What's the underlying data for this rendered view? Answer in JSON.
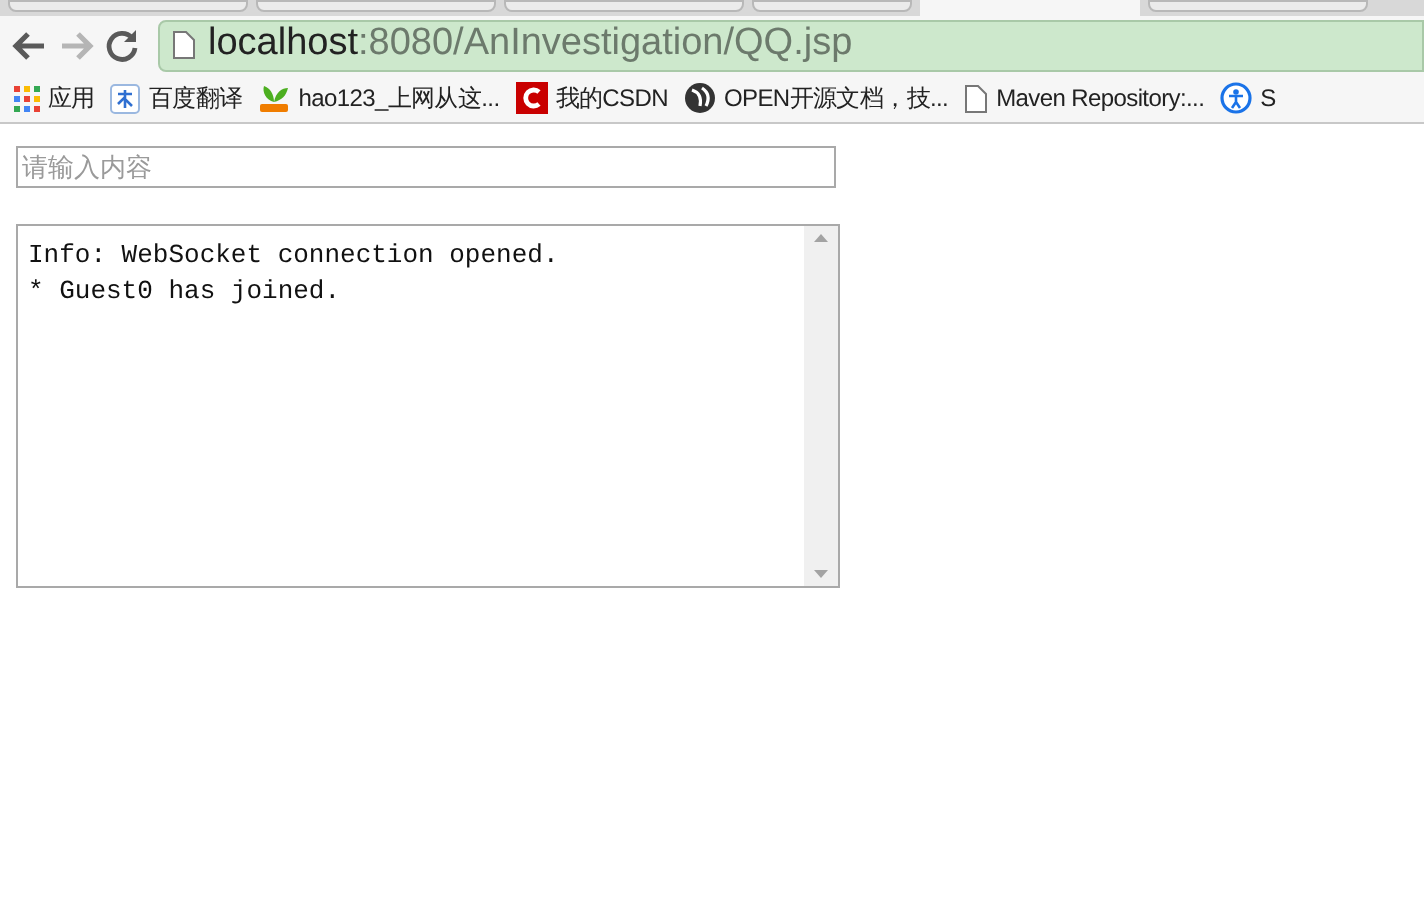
{
  "toolbar": {
    "url_host": "localhost",
    "url_path": ":8080/AnInvestigation/QQ.jsp",
    "forward_disabled": true
  },
  "bookmarks": [
    {
      "label": "应用",
      "kind": "apps"
    },
    {
      "label": "百度翻译",
      "kind": "translate"
    },
    {
      "label": "hao123_上网从这...",
      "kind": "hao"
    },
    {
      "label": "我的CSDN",
      "kind": "csdn"
    },
    {
      "label": "OPEN开源文档，技...",
      "kind": "globe"
    },
    {
      "label": "Maven Repository:...",
      "kind": "page"
    },
    {
      "label": "S",
      "kind": "circle"
    }
  ],
  "message_input": {
    "placeholder": "请输入内容"
  },
  "log": {
    "lines": [
      "Info: WebSocket connection opened.",
      "* Guest0 has joined."
    ]
  }
}
